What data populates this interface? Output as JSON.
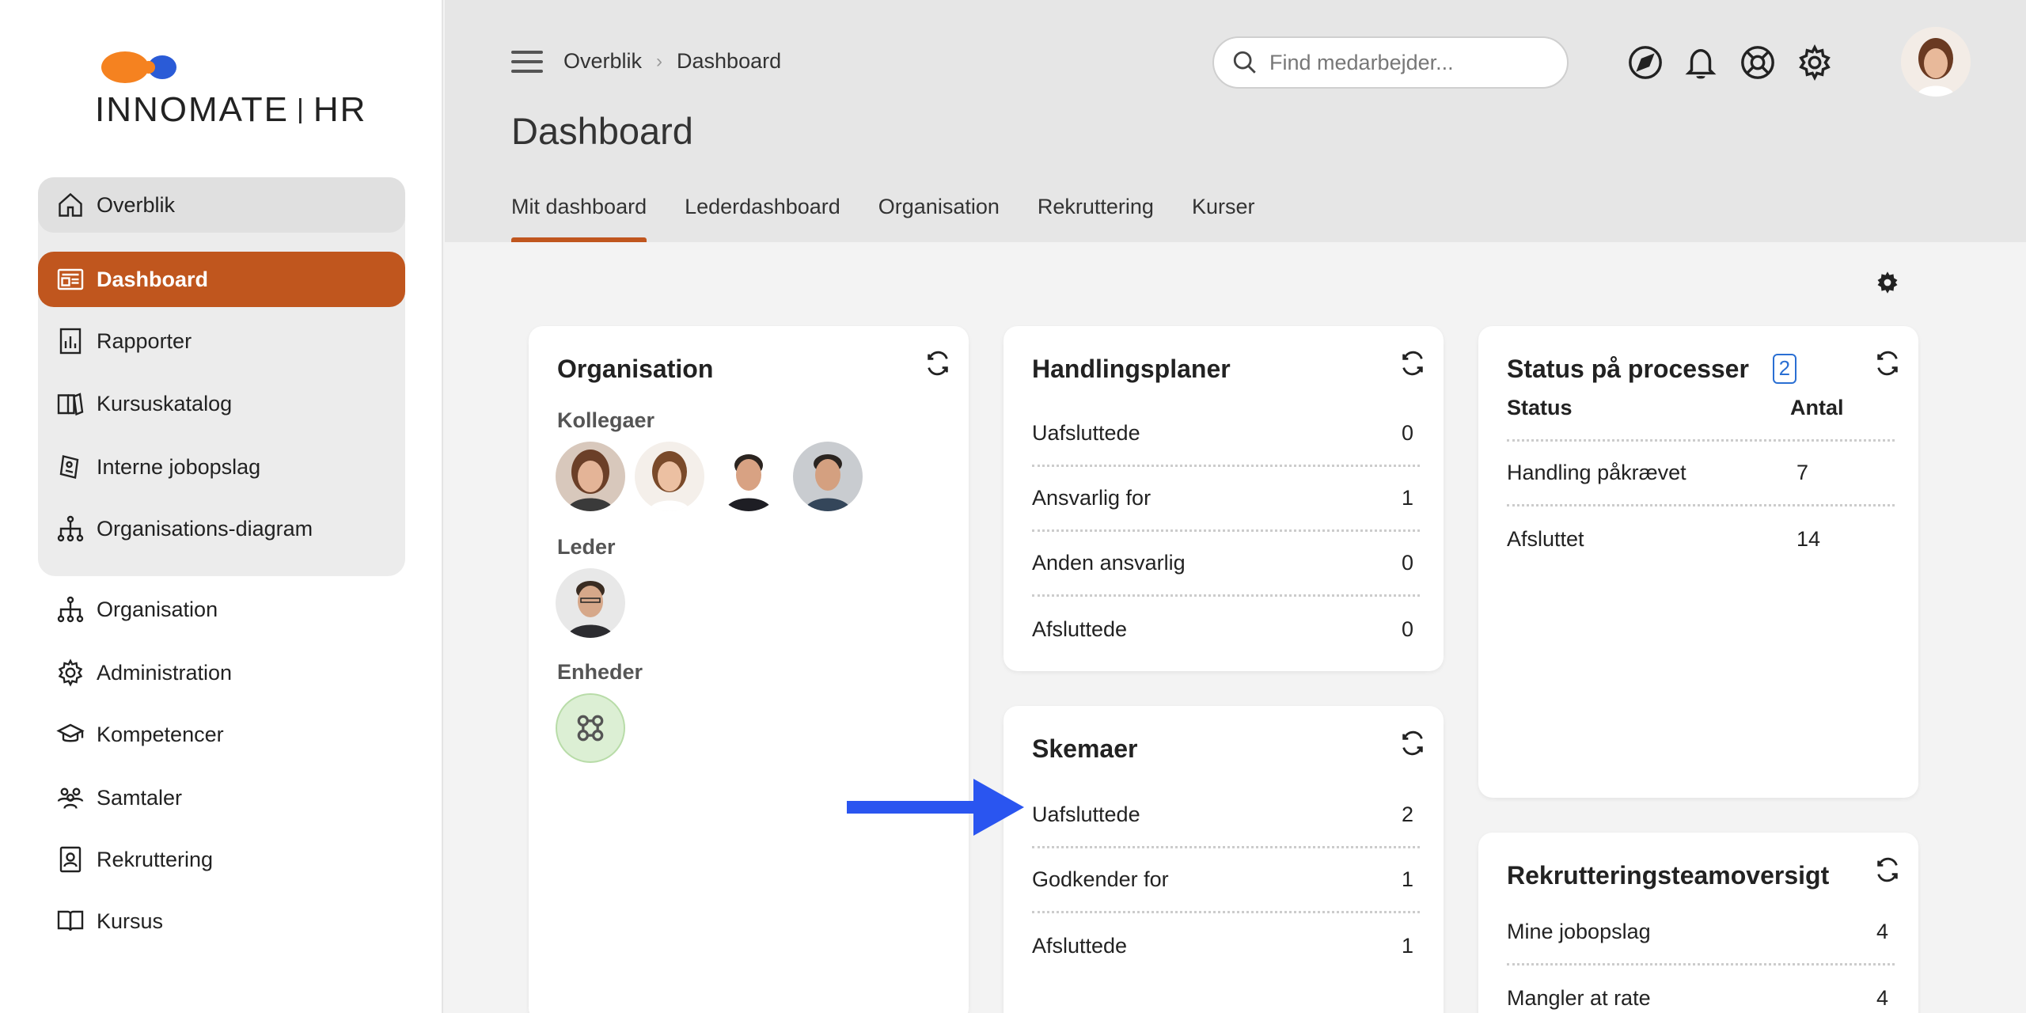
{
  "brand": {
    "name_part1": "INNO",
    "name_part2": "MATE",
    "name_part3": "HR",
    "accent": "#c0561e",
    "logo_orange": "#f58220",
    "logo_blue": "#2a5bd7"
  },
  "sidebar": {
    "group_items": [
      {
        "label": "Overblik",
        "icon": "home-icon"
      },
      {
        "label": "Dashboard",
        "icon": "dashboard-icon"
      },
      {
        "label": "Rapporter",
        "icon": "report-icon"
      },
      {
        "label": "Kursuskatalog",
        "icon": "catalog-icon"
      },
      {
        "label": "Interne jobopslag",
        "icon": "job-posting-icon"
      },
      {
        "label": "Organisations-diagram",
        "icon": "org-chart-icon"
      }
    ],
    "items": [
      {
        "label": "Organisation",
        "icon": "org-chart-icon"
      },
      {
        "label": "Administration",
        "icon": "gear-icon"
      },
      {
        "label": "Kompetencer",
        "icon": "graduation-cap-icon"
      },
      {
        "label": "Samtaler",
        "icon": "people-icon"
      },
      {
        "label": "Rekruttering",
        "icon": "id-badge-icon"
      },
      {
        "label": "Kursus",
        "icon": "book-icon"
      }
    ]
  },
  "header": {
    "breadcrumb": [
      "Overblik",
      "Dashboard"
    ],
    "title": "Dashboard",
    "search_placeholder": "Find medarbejder...",
    "icons": [
      "navigate-icon",
      "bell-icon",
      "help-icon",
      "gear-icon"
    ],
    "tabs": [
      "Mit dashboard",
      "Lederdashboard",
      "Organisation",
      "Rekruttering",
      "Kurser"
    ],
    "active_tab": "Mit dashboard"
  },
  "cards": {
    "organisation": {
      "title": "Organisation",
      "colleagues_label": "Kollegaer",
      "leader_label": "Leder",
      "units_label": "Enheder"
    },
    "handlingsplaner": {
      "title": "Handlingsplaner",
      "rows": [
        {
          "label": "Uafsluttede",
          "value": "0"
        },
        {
          "label": "Ansvarlig for",
          "value": "1"
        },
        {
          "label": "Anden ansvarlig",
          "value": "0"
        },
        {
          "label": "Afsluttede",
          "value": "0"
        }
      ]
    },
    "skemaer": {
      "title": "Skemaer",
      "rows": [
        {
          "label": "Uafsluttede",
          "value": "2"
        },
        {
          "label": "Godkender for",
          "value": "1"
        },
        {
          "label": "Afsluttede",
          "value": "1"
        }
      ]
    },
    "status": {
      "title": "Status på processer",
      "badge": "2",
      "col_status": "Status",
      "col_count": "Antal",
      "rows": [
        {
          "label": "Handling påkrævet",
          "value": "7"
        },
        {
          "label": "Afsluttet",
          "value": "14"
        }
      ]
    },
    "rekruttering": {
      "title": "Rekrutteringsteamoversigt",
      "rows": [
        {
          "label": "Mine jobopslag",
          "value": "4"
        },
        {
          "label": "Mangler at rate",
          "value": "4"
        }
      ]
    }
  },
  "annotation": {
    "arrow_color": "#2a55f0"
  }
}
